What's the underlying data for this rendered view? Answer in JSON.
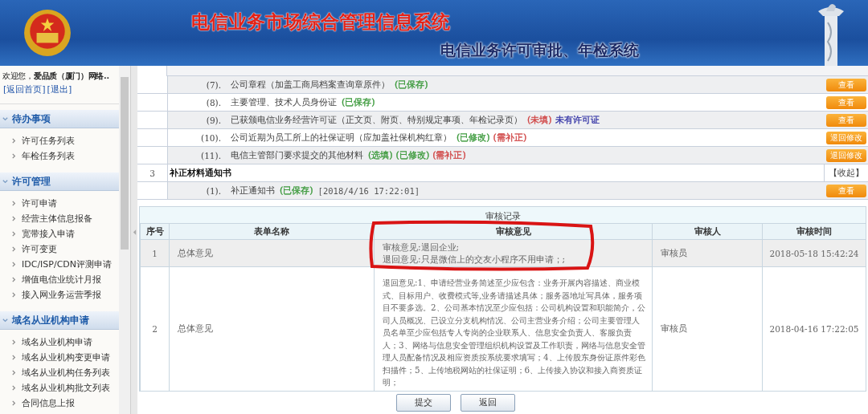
{
  "header": {
    "title": "电信业务市场综合管理信息系统",
    "subtitle": "电信业务许可审批、年检系统"
  },
  "sidebar": {
    "welcome": "欢迎您，",
    "user": "爱品质（厦门）网络..",
    "links": [
      "[返回首页]",
      "[退出]"
    ],
    "sections": [
      {
        "title": "待办事项",
        "expanded": true,
        "items": [
          "许可任务列表",
          "年检任务列表"
        ]
      },
      {
        "title": "许可管理",
        "expanded": true,
        "items": [
          "许可申请",
          "经营主体信息报备",
          "宽带接入申请",
          "许可变更",
          "IDC/ISP/CDN评测申请",
          "增值电信业统计月报",
          "接入网业务运营季报"
        ]
      },
      {
        "title": "域名从业机构申请",
        "expanded": true,
        "items": [
          "域名从业机构申请",
          "域名从业机构变更申请",
          "域名从业机构任务列表",
          "域名从业机构批文列表",
          "合同信息上报"
        ]
      }
    ]
  },
  "materials": [
    {
      "kind": "item",
      "number": "(7).",
      "name": "公司章程（加盖工商局档案查询章原件）",
      "tags": [
        {
          "text": "(已保存)",
          "color": "#3c9a3c"
        }
      ],
      "button": "查看"
    },
    {
      "kind": "item",
      "number": "(8).",
      "name": "主要管理、技术人员身份证",
      "tags": [
        {
          "text": "(已保存)",
          "color": "#3c9a3c"
        }
      ],
      "button": "查看"
    },
    {
      "kind": "item",
      "number": "(9).",
      "name": "已获颁电信业务经营许可证（正文页、附页、特别规定事项、年检记录页）",
      "tags": [
        {
          "text": "(未填)",
          "color": "#d04646"
        },
        {
          "text": "未有许可证",
          "color": "#3a3aa8"
        }
      ],
      "button": "查看"
    },
    {
      "kind": "item",
      "number": "(10).",
      "name": "公司近期为员工所上的社保证明（应加盖社保机构红章）",
      "tags": [
        {
          "text": "(已修改)",
          "color": "#3c9a3c"
        },
        {
          "text": "(需补正)",
          "color": "#d04646"
        }
      ],
      "button": "退回修改"
    },
    {
      "kind": "item",
      "number": "(11).",
      "name": "电信主管部门要求提交的其他材料",
      "tags": [
        {
          "text": "(选填)",
          "color": "#3c9a3c"
        },
        {
          "text": "(已修改)",
          "color": "#3c9a3c"
        },
        {
          "text": "(需补正)",
          "color": "#d04646"
        }
      ],
      "button": "退回修改"
    },
    {
      "kind": "section",
      "index": "3",
      "title": "补正材料通知书",
      "action": "【收起】"
    },
    {
      "kind": "item",
      "number": "(1).",
      "name": "补正通知书",
      "tags": [
        {
          "text": "(已保存)",
          "color": "#3c9a3c"
        }
      ],
      "timestamp": "[2018/4/16 17:22:01]",
      "button": "查看"
    }
  ],
  "review": {
    "caption": "审核记录",
    "columns": [
      "序号",
      "表单名称",
      "审核意见",
      "审核人",
      "审核时间"
    ],
    "rows": [
      {
        "index": "1",
        "form": "总体意见",
        "opinion": [
          "审核意见:退回企业;",
          "退回意见:只是微信上的交友小程序不用申请；;"
        ],
        "reviewer": "审核员",
        "time": "2018-05-18 15:42:24",
        "selected": true
      },
      {
        "index": "2",
        "form": "总体意见",
        "opinion": [
          "退回意见:1、申请经营业务简述至少应包含：业务开展内容描述、商业模式、目标用户、收费模式等,业务请描述具体；服务器地址写具体，服务项目不要多选。2、公司基本情况至少应包括：公司机构设置和职能简介，公司人员概况、已设立分支机构情况、公司主营业务介绍；公司主要管理人员名单至少应包括专人专岗的企业联系人、信息安全负责人、客服负责人；3、网络与信息安全管理组织机构设置及工作职责，网络与信息安全管理人员配备情况及相应资质按系统要求填写；4、上传股东身份证原件彩色扫描件；5、上传地税网站的社保证明；6、上传接入协议和接入商资质证明；"
        ],
        "reviewer": "审核员",
        "time": "2018-04-16 17:22:05",
        "selected": false
      }
    ]
  },
  "buttons": [
    "提交",
    "返回"
  ]
}
